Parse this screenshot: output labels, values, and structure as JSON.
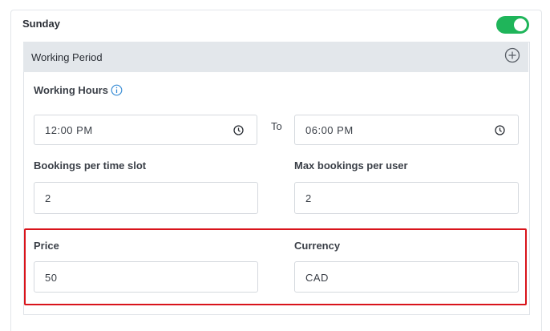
{
  "day": {
    "label": "Sunday",
    "enabled": true,
    "toggle_color": "#1fb55a"
  },
  "working_period": {
    "title": "Working Period",
    "add_icon": "plus-circle-icon"
  },
  "working_hours": {
    "label": "Working Hours",
    "info_icon": "info-icon",
    "start": "12:00 PM",
    "to_label": "To",
    "end": "06:00 PM"
  },
  "bookings": {
    "per_slot_label": "Bookings per time slot",
    "per_slot_value": "2",
    "max_per_user_label": "Max bookings per user",
    "max_per_user_value": "2"
  },
  "pricing": {
    "price_label": "Price",
    "price_value": "50",
    "currency_label": "Currency",
    "currency_value": "CAD",
    "highlight_color": "#d9141b"
  }
}
